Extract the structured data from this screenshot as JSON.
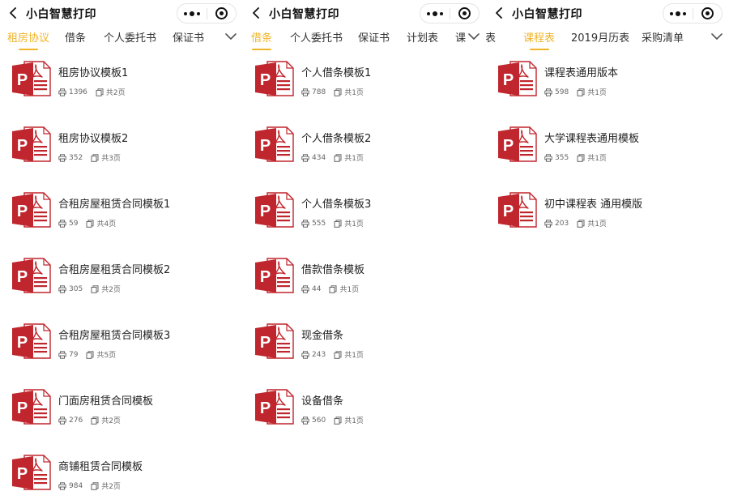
{
  "app": {
    "title": "小白智慧打印"
  },
  "panels": [
    {
      "tabs": [
        "租房协议",
        "借条",
        "个人委托书",
        "保证书"
      ],
      "active_tab": 0,
      "items": [
        {
          "title": "租房协议模板1",
          "prints": "1396",
          "pages": "共2页"
        },
        {
          "title": "租房协议模板2",
          "prints": "352",
          "pages": "共3页"
        },
        {
          "title": "合租房屋租赁合同模板1",
          "prints": "59",
          "pages": "共4页"
        },
        {
          "title": "合租房屋租赁合同模板2",
          "prints": "305",
          "pages": "共2页"
        },
        {
          "title": "合租房屋租赁合同模板3",
          "prints": "79",
          "pages": "共5页"
        },
        {
          "title": "门面房租赁合同模板",
          "prints": "276",
          "pages": "共2页"
        },
        {
          "title": "商铺租赁合同模板",
          "prints": "984",
          "pages": "共2页"
        }
      ]
    },
    {
      "tabs": [
        "借条",
        "个人委托书",
        "保证书",
        "计划表",
        "课"
      ],
      "active_tab": 0,
      "items": [
        {
          "title": "个人借条模板1",
          "prints": "788",
          "pages": "共1页"
        },
        {
          "title": "个人借条模板2",
          "prints": "434",
          "pages": "共1页"
        },
        {
          "title": "个人借条模板3",
          "prints": "555",
          "pages": "共1页"
        },
        {
          "title": "借款借条模板",
          "prints": "44",
          "pages": "共1页"
        },
        {
          "title": "现金借条",
          "prints": "243",
          "pages": "共1页"
        },
        {
          "title": "设备借条",
          "prints": "560",
          "pages": "共1页"
        }
      ]
    },
    {
      "tabs": [
        "划表",
        "课程表",
        "2019月历表",
        "采购清单"
      ],
      "active_tab": 1,
      "items": [
        {
          "title": "课程表通用版本",
          "prints": "598",
          "pages": "共1页"
        },
        {
          "title": "大学课程表通用模板",
          "prints": "355",
          "pages": "共1页"
        },
        {
          "title": "初中课程表 通用模版",
          "prints": "203",
          "pages": "共1页"
        }
      ]
    }
  ],
  "icons": {
    "back": "chevron-left-icon",
    "more": "more-dots-icon",
    "close": "target-circle-icon",
    "tab_more": "chevron-down-icon",
    "document": "pdf-document-icon",
    "print": "printer-icon",
    "pages": "pages-icon"
  },
  "colors": {
    "accent": "#f0b429",
    "pdf_red": "#c0262d",
    "text": "#222222",
    "meta": "#666666"
  }
}
